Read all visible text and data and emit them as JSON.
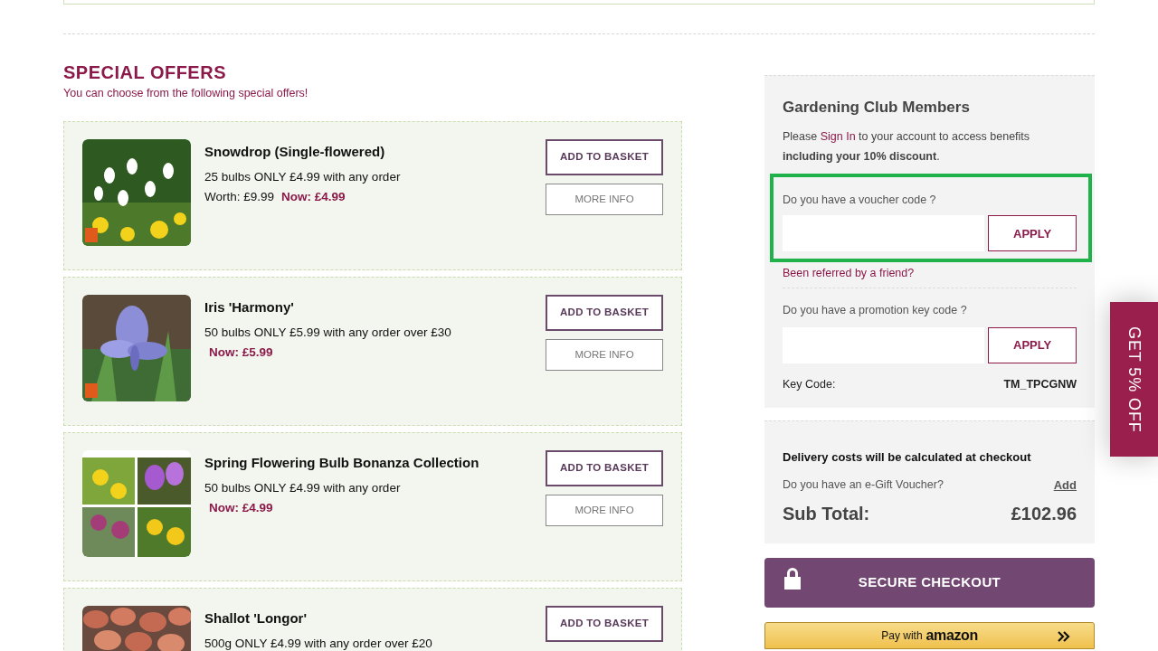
{
  "offers_section": {
    "title": "SPECIAL OFFERS",
    "subtitle": "You can choose from the following special offers!"
  },
  "offers": [
    {
      "name": "Snowdrop (Single-flowered)",
      "description": "25 bulbs ONLY £4.99 with any order",
      "worth": "Worth: £9.99",
      "now": "Now: £4.99",
      "add_button": "ADD TO BASKET",
      "info_button": "MORE INFO"
    },
    {
      "name": "Iris 'Harmony'",
      "description": "50 bulbs ONLY £5.99 with any order over £30",
      "now": "Now: £5.99",
      "add_button": "ADD TO BASKET",
      "info_button": "MORE INFO"
    },
    {
      "name": "Spring Flowering Bulb Bonanza Collection",
      "description": "50 bulbs ONLY £4.99 with any order",
      "now": "Now: £4.99",
      "add_button": "ADD TO BASKET",
      "info_button": "MORE INFO"
    },
    {
      "name": "Shallot 'Longor'",
      "description": "500g ONLY £4.99 with any order over £20",
      "add_button": "ADD TO BASKET"
    }
  ],
  "club": {
    "title": "Gardening Club Members",
    "intro_before": "Please ",
    "sign_in_link": "Sign In",
    "intro_after": " to your account to access benefits",
    "intro_bold": "including your 10% discount",
    "intro_end": ".",
    "voucher": {
      "label": "Do you have a voucher code ?",
      "button": "APPLY",
      "highlighted": true
    },
    "referral_link": "Been referred by a friend?",
    "promotion": {
      "label": "Do you have a promotion key code ?",
      "button": "APPLY"
    },
    "key_code_label": "Key Code:",
    "key_code": "TM_TPCGNW"
  },
  "summary": {
    "delivery_note": "Delivery costs will be calculated at checkout",
    "gift_question": "Do you have an e-Gift Voucher?",
    "gift_link": "Add",
    "subtotal_label": "Sub Total:",
    "subtotal": "£102.96"
  },
  "checkout_button": "SECURE CHECKOUT",
  "amazon_button": {
    "prefix": "Pay with",
    "brand": "amazon"
  },
  "side_tab": "GET 5% OFF"
}
